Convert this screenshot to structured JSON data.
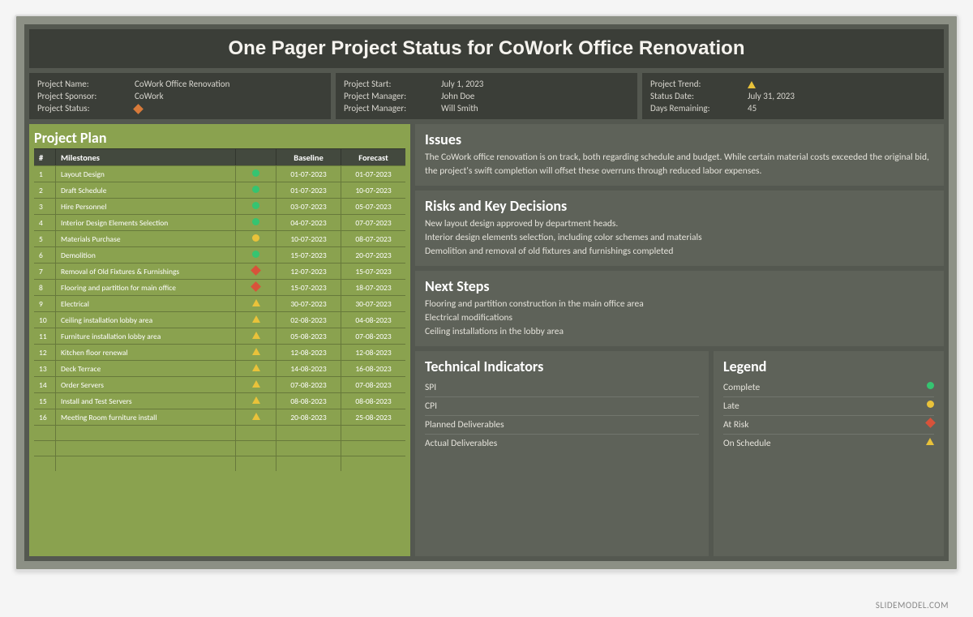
{
  "title": "One Pager Project Status for CoWork Office Renovation",
  "brand": "SLIDEMODEL.COM",
  "meta": {
    "box1": [
      {
        "label": "Project Name:",
        "value": "CoWork Office Renovation"
      },
      {
        "label": "Project Sponsor:",
        "value": "CoWork"
      },
      {
        "label": "Project Status:",
        "value": "",
        "shape": "diamond-orange"
      }
    ],
    "box2": [
      {
        "label": "Project Start:",
        "value": "July 1, 2023"
      },
      {
        "label": "Project Manager:",
        "value": "John Doe"
      },
      {
        "label": "Project Manager:",
        "value": "Will Smith"
      }
    ],
    "box3": [
      {
        "label": "Project Trend:",
        "value": "",
        "shape": "triangle-yellow"
      },
      {
        "label": "Status Date:",
        "value": "July 31, 2023"
      },
      {
        "label": "Days Remaining:",
        "value": "45"
      }
    ]
  },
  "plan": {
    "title": "Project Plan",
    "headers": {
      "num": "#",
      "milestone": "Milestones",
      "status": "",
      "baseline": "Baseline",
      "forecast": "Forecast"
    },
    "rows": [
      {
        "num": "1",
        "milestone": "Layout Design",
        "status": "circle-green",
        "baseline": "01-07-2023",
        "forecast": "01-07-2023"
      },
      {
        "num": "2",
        "milestone": "Draft Schedule",
        "status": "circle-green",
        "baseline": "01-07-2023",
        "forecast": "10-07-2023"
      },
      {
        "num": "3",
        "milestone": "Hire Personnel",
        "status": "circle-green",
        "baseline": "03-07-2023",
        "forecast": "05-07-2023"
      },
      {
        "num": "4",
        "milestone": "Interior Design Elements Selection",
        "status": "circle-green",
        "baseline": "04-07-2023",
        "forecast": "07-07-2023"
      },
      {
        "num": "5",
        "milestone": "Materials Purchase",
        "status": "circle-yellow",
        "baseline": "10-07-2023",
        "forecast": "08-07-2023"
      },
      {
        "num": "6",
        "milestone": "Demolition",
        "status": "circle-green",
        "baseline": "15-07-2023",
        "forecast": "20-07-2023"
      },
      {
        "num": "7",
        "milestone": "Removal of Old Fixtures & Furnishings",
        "status": "diamond-red",
        "baseline": "12-07-2023",
        "forecast": "15-07-2023"
      },
      {
        "num": "8",
        "milestone": "Flooring and partition for main office",
        "status": "diamond-red",
        "baseline": "15-07-2023",
        "forecast": "18-07-2023"
      },
      {
        "num": "9",
        "milestone": "Electrical",
        "status": "triangle-yellow",
        "baseline": "30-07-2023",
        "forecast": "30-07-2023"
      },
      {
        "num": "10",
        "milestone": "Ceiling installation lobby area",
        "status": "triangle-yellow",
        "baseline": "02-08-2023",
        "forecast": "04-08-2023"
      },
      {
        "num": "11",
        "milestone": "Furniture installation lobby area",
        "status": "triangle-yellow",
        "baseline": "05-08-2023",
        "forecast": "07-08-2023"
      },
      {
        "num": "12",
        "milestone": "Kitchen floor renewal",
        "status": "triangle-yellow",
        "baseline": "12-08-2023",
        "forecast": "12-08-2023"
      },
      {
        "num": "13",
        "milestone": "Deck Terrace",
        "status": "triangle-yellow",
        "baseline": "14-08-2023",
        "forecast": "16-08-2023"
      },
      {
        "num": "14",
        "milestone": "Order Servers",
        "status": "triangle-yellow",
        "baseline": "07-08-2023",
        "forecast": "07-08-2023"
      },
      {
        "num": "15",
        "milestone": "Install and Test Servers",
        "status": "triangle-yellow",
        "baseline": "08-08-2023",
        "forecast": "08-08-2023"
      },
      {
        "num": "16",
        "milestone": "Meeting Room furniture install",
        "status": "triangle-yellow",
        "baseline": "20-08-2023",
        "forecast": "25-08-2023"
      }
    ],
    "empty_rows": 3
  },
  "issues": {
    "title": "Issues",
    "text": "The CoWork office renovation is on track, both regarding schedule and budget. While certain material costs exceeded the original bid, the project's swift completion will offset these overruns through reduced labor expenses."
  },
  "risks": {
    "title": "Risks and Key Decisions",
    "lines": [
      "New layout design approved by department heads.",
      "Interior design elements selection, including color schemes and materials",
      "Demolition and removal of old fixtures and furnishings completed"
    ]
  },
  "next": {
    "title": "Next Steps",
    "lines": [
      "Flooring and partition construction in the main office area",
      "Electrical modifications",
      "Ceiling installations in the lobby area"
    ]
  },
  "tech": {
    "title": "Technical Indicators",
    "items": [
      "SPI",
      "CPI",
      "Planned Deliverables",
      "Actual Deliverables"
    ]
  },
  "legend": {
    "title": "Legend",
    "items": [
      {
        "label": "Complete",
        "shape": "circle-green"
      },
      {
        "label": "Late",
        "shape": "circle-yellow"
      },
      {
        "label": "At Risk",
        "shape": "diamond-red"
      },
      {
        "label": "On Schedule",
        "shape": "triangle-yellow"
      }
    ]
  }
}
